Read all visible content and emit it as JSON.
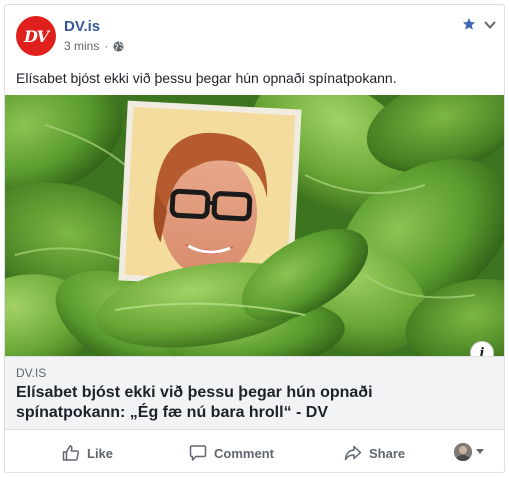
{
  "post": {
    "page_name": "DV.is",
    "avatar_text": "DV",
    "timestamp": "3 mins",
    "separator": "·",
    "message": "Elísabet bjóst ekki við þessu þegar hún opnaði spínatpokann."
  },
  "link_preview": {
    "domain": "DV.IS",
    "headline": "Elísabet bjóst ekki við þessu þegar hún opnaði spínatpokann: „Ég fæ nú bara hroll“ - DV",
    "info_label": "i"
  },
  "actions": {
    "like_label": "Like",
    "comment_label": "Comment",
    "share_label": "Share"
  },
  "icons": {
    "star": "star-icon",
    "globe": "globe-icon",
    "like": "thumbs-up-icon",
    "comment": "speech-bubble-icon",
    "share": "share-arrow-icon"
  },
  "colors": {
    "brand_red": "#e0201d",
    "link_blue": "#365899",
    "star_blue": "#4267b2",
    "muted": "#606770",
    "preview_bg": "#f2f3f5"
  }
}
